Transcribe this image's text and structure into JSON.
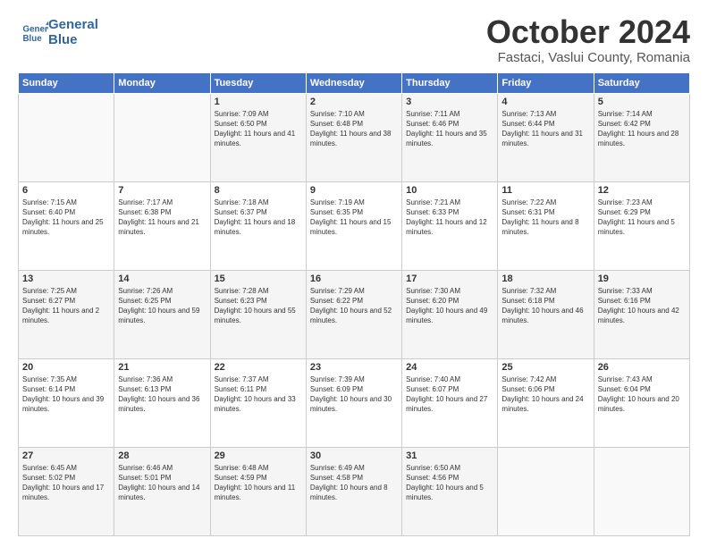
{
  "logo": {
    "line1": "General",
    "line2": "Blue"
  },
  "title": "October 2024",
  "location": "Fastaci, Vaslui County, Romania",
  "weekdays": [
    "Sunday",
    "Monday",
    "Tuesday",
    "Wednesday",
    "Thursday",
    "Friday",
    "Saturday"
  ],
  "weeks": [
    [
      {
        "day": "",
        "info": ""
      },
      {
        "day": "",
        "info": ""
      },
      {
        "day": "1",
        "info": "Sunrise: 7:09 AM\nSunset: 6:50 PM\nDaylight: 11 hours and 41 minutes."
      },
      {
        "day": "2",
        "info": "Sunrise: 7:10 AM\nSunset: 6:48 PM\nDaylight: 11 hours and 38 minutes."
      },
      {
        "day": "3",
        "info": "Sunrise: 7:11 AM\nSunset: 6:46 PM\nDaylight: 11 hours and 35 minutes."
      },
      {
        "day": "4",
        "info": "Sunrise: 7:13 AM\nSunset: 6:44 PM\nDaylight: 11 hours and 31 minutes."
      },
      {
        "day": "5",
        "info": "Sunrise: 7:14 AM\nSunset: 6:42 PM\nDaylight: 11 hours and 28 minutes."
      }
    ],
    [
      {
        "day": "6",
        "info": "Sunrise: 7:15 AM\nSunset: 6:40 PM\nDaylight: 11 hours and 25 minutes."
      },
      {
        "day": "7",
        "info": "Sunrise: 7:17 AM\nSunset: 6:38 PM\nDaylight: 11 hours and 21 minutes."
      },
      {
        "day": "8",
        "info": "Sunrise: 7:18 AM\nSunset: 6:37 PM\nDaylight: 11 hours and 18 minutes."
      },
      {
        "day": "9",
        "info": "Sunrise: 7:19 AM\nSunset: 6:35 PM\nDaylight: 11 hours and 15 minutes."
      },
      {
        "day": "10",
        "info": "Sunrise: 7:21 AM\nSunset: 6:33 PM\nDaylight: 11 hours and 12 minutes."
      },
      {
        "day": "11",
        "info": "Sunrise: 7:22 AM\nSunset: 6:31 PM\nDaylight: 11 hours and 8 minutes."
      },
      {
        "day": "12",
        "info": "Sunrise: 7:23 AM\nSunset: 6:29 PM\nDaylight: 11 hours and 5 minutes."
      }
    ],
    [
      {
        "day": "13",
        "info": "Sunrise: 7:25 AM\nSunset: 6:27 PM\nDaylight: 11 hours and 2 minutes."
      },
      {
        "day": "14",
        "info": "Sunrise: 7:26 AM\nSunset: 6:25 PM\nDaylight: 10 hours and 59 minutes."
      },
      {
        "day": "15",
        "info": "Sunrise: 7:28 AM\nSunset: 6:23 PM\nDaylight: 10 hours and 55 minutes."
      },
      {
        "day": "16",
        "info": "Sunrise: 7:29 AM\nSunset: 6:22 PM\nDaylight: 10 hours and 52 minutes."
      },
      {
        "day": "17",
        "info": "Sunrise: 7:30 AM\nSunset: 6:20 PM\nDaylight: 10 hours and 49 minutes."
      },
      {
        "day": "18",
        "info": "Sunrise: 7:32 AM\nSunset: 6:18 PM\nDaylight: 10 hours and 46 minutes."
      },
      {
        "day": "19",
        "info": "Sunrise: 7:33 AM\nSunset: 6:16 PM\nDaylight: 10 hours and 42 minutes."
      }
    ],
    [
      {
        "day": "20",
        "info": "Sunrise: 7:35 AM\nSunset: 6:14 PM\nDaylight: 10 hours and 39 minutes."
      },
      {
        "day": "21",
        "info": "Sunrise: 7:36 AM\nSunset: 6:13 PM\nDaylight: 10 hours and 36 minutes."
      },
      {
        "day": "22",
        "info": "Sunrise: 7:37 AM\nSunset: 6:11 PM\nDaylight: 10 hours and 33 minutes."
      },
      {
        "day": "23",
        "info": "Sunrise: 7:39 AM\nSunset: 6:09 PM\nDaylight: 10 hours and 30 minutes."
      },
      {
        "day": "24",
        "info": "Sunrise: 7:40 AM\nSunset: 6:07 PM\nDaylight: 10 hours and 27 minutes."
      },
      {
        "day": "25",
        "info": "Sunrise: 7:42 AM\nSunset: 6:06 PM\nDaylight: 10 hours and 24 minutes."
      },
      {
        "day": "26",
        "info": "Sunrise: 7:43 AM\nSunset: 6:04 PM\nDaylight: 10 hours and 20 minutes."
      }
    ],
    [
      {
        "day": "27",
        "info": "Sunrise: 6:45 AM\nSunset: 5:02 PM\nDaylight: 10 hours and 17 minutes."
      },
      {
        "day": "28",
        "info": "Sunrise: 6:46 AM\nSunset: 5:01 PM\nDaylight: 10 hours and 14 minutes."
      },
      {
        "day": "29",
        "info": "Sunrise: 6:48 AM\nSunset: 4:59 PM\nDaylight: 10 hours and 11 minutes."
      },
      {
        "day": "30",
        "info": "Sunrise: 6:49 AM\nSunset: 4:58 PM\nDaylight: 10 hours and 8 minutes."
      },
      {
        "day": "31",
        "info": "Sunrise: 6:50 AM\nSunset: 4:56 PM\nDaylight: 10 hours and 5 minutes."
      },
      {
        "day": "",
        "info": ""
      },
      {
        "day": "",
        "info": ""
      }
    ]
  ]
}
